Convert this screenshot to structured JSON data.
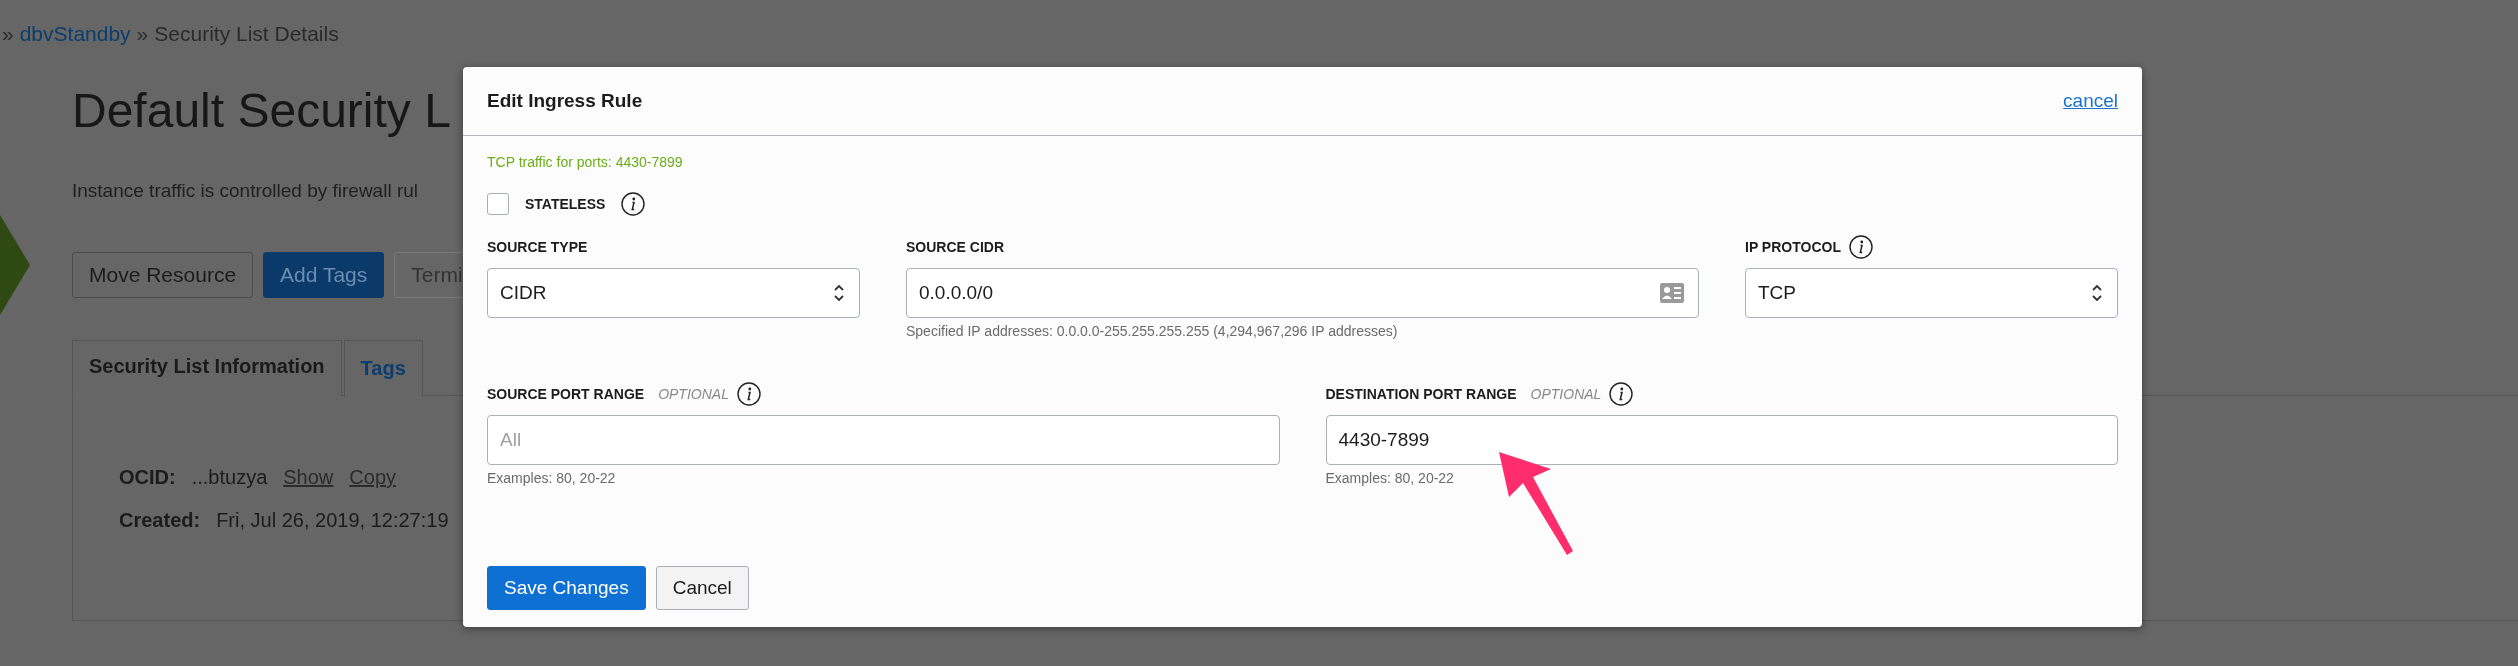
{
  "breadcrumb": [
    {
      "text": "»",
      "kind": "separator"
    },
    {
      "text": "dbvStandby",
      "kind": "link"
    },
    {
      "text": "»",
      "kind": "separator"
    },
    {
      "text": "Security List Details",
      "kind": "current"
    }
  ],
  "page": {
    "title": "Default Security L",
    "description": "Instance traffic is controlled by firewall rul",
    "buttons": [
      {
        "label": "Move Resource",
        "kind": "secondary",
        "disabled": false
      },
      {
        "label": "Add Tags",
        "kind": "primary",
        "disabled": false
      },
      {
        "label": "Termi",
        "kind": "secondary",
        "disabled": true
      }
    ],
    "tabs": [
      {
        "label": "Security List Information",
        "selected": true
      },
      {
        "label": "Tags",
        "selected": false
      }
    ],
    "details": [
      {
        "label": "OCID:",
        "value": "...btuzya",
        "links": [
          "Show",
          "Copy"
        ]
      },
      {
        "label": "Created:",
        "value": "Fri, Jul 26, 2019, 12:27:19"
      }
    ]
  },
  "dialog": {
    "title": "Edit Ingress Rule",
    "cancel_link": "cancel",
    "summary": "TCP traffic for ports: 4430-7899",
    "stateless": {
      "label": "STATELESS",
      "checked": false,
      "info": true
    },
    "fields": [
      {
        "kind": "select",
        "label": "SOURCE TYPE",
        "info": false,
        "value": "CIDR"
      },
      {
        "kind": "lookup",
        "label": "SOURCE CIDR",
        "info": false,
        "value": "0.0.0.0/0",
        "helper": "Specified IP addresses: 0.0.0.0-255.255.255.255 (4,294,967,296 IP addresses)"
      },
      {
        "kind": "select",
        "label": "IP PROTOCOL",
        "info": true,
        "value": "TCP"
      }
    ],
    "port_fields": [
      {
        "label": "SOURCE PORT RANGE",
        "optional": "OPTIONAL",
        "info": true,
        "placeholder": "All",
        "helper": "Examples: 80, 20-22"
      },
      {
        "label": "DESTINATION PORT RANGE",
        "optional": "OPTIONAL",
        "info": true,
        "value": "4430-7899",
        "helper": "Examples: 80, 20-22"
      }
    ],
    "buttons": [
      {
        "label": "Save Changes",
        "kind": "primary"
      },
      {
        "label": "Cancel",
        "kind": "secondary"
      }
    ]
  }
}
